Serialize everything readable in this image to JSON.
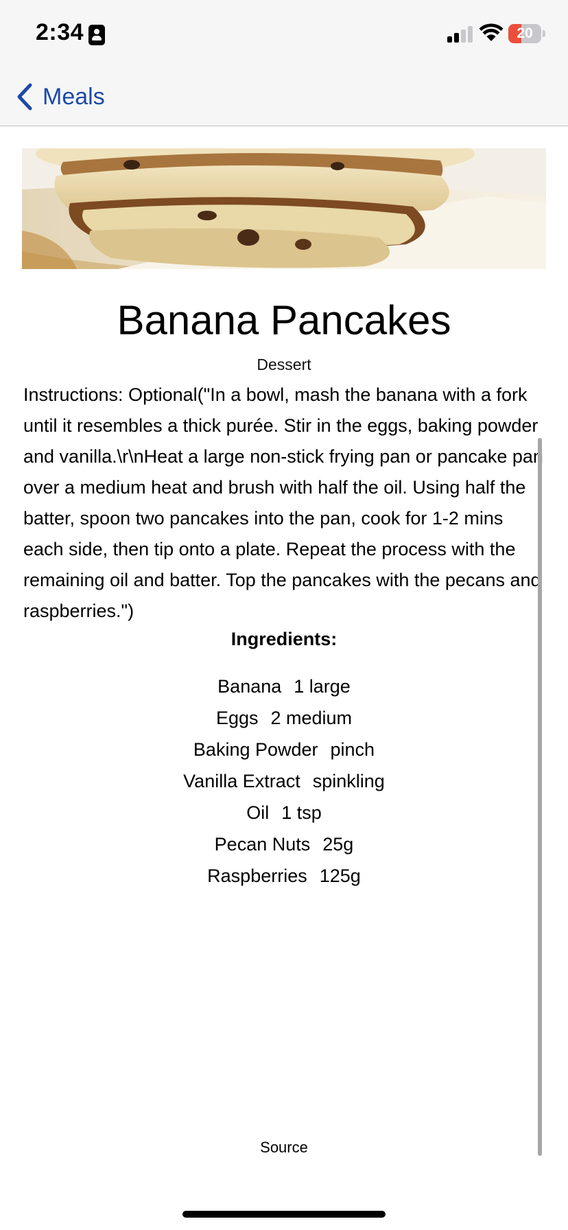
{
  "status_bar": {
    "time": "2:34",
    "battery_level": "20",
    "battery_color": "#eb4e3d"
  },
  "nav": {
    "back_label": "Meals",
    "accent_color": "#1c49a8"
  },
  "meal": {
    "title": "Banana Pancakes",
    "category": "Dessert",
    "instructions": "Instructions: Optional(\"In a bowl, mash the banana with a fork until it resembles a thick purée. Stir in the eggs, baking powder and vanilla.\\r\\nHeat a large non-stick frying pan or pancake pan over a medium heat and brush with half the oil. Using half the batter, spoon two pancakes into the pan, cook for 1-2 mins each side, then tip onto a plate. Repeat the process with the remaining oil and batter. Top the pancakes with the pecans and raspberries.\")",
    "ingredients_heading": "Ingredients:",
    "ingredients": [
      {
        "name": "Banana",
        "measure": "1 large"
      },
      {
        "name": "Eggs",
        "measure": "2 medium"
      },
      {
        "name": "Baking Powder",
        "measure": "pinch"
      },
      {
        "name": "Vanilla Extract",
        "measure": "spinkling"
      },
      {
        "name": "Oil",
        "measure": "1 tsp"
      },
      {
        "name": "Pecan Nuts",
        "measure": "25g"
      },
      {
        "name": "Raspberries",
        "measure": "125g"
      }
    ],
    "source_label": "Source"
  }
}
